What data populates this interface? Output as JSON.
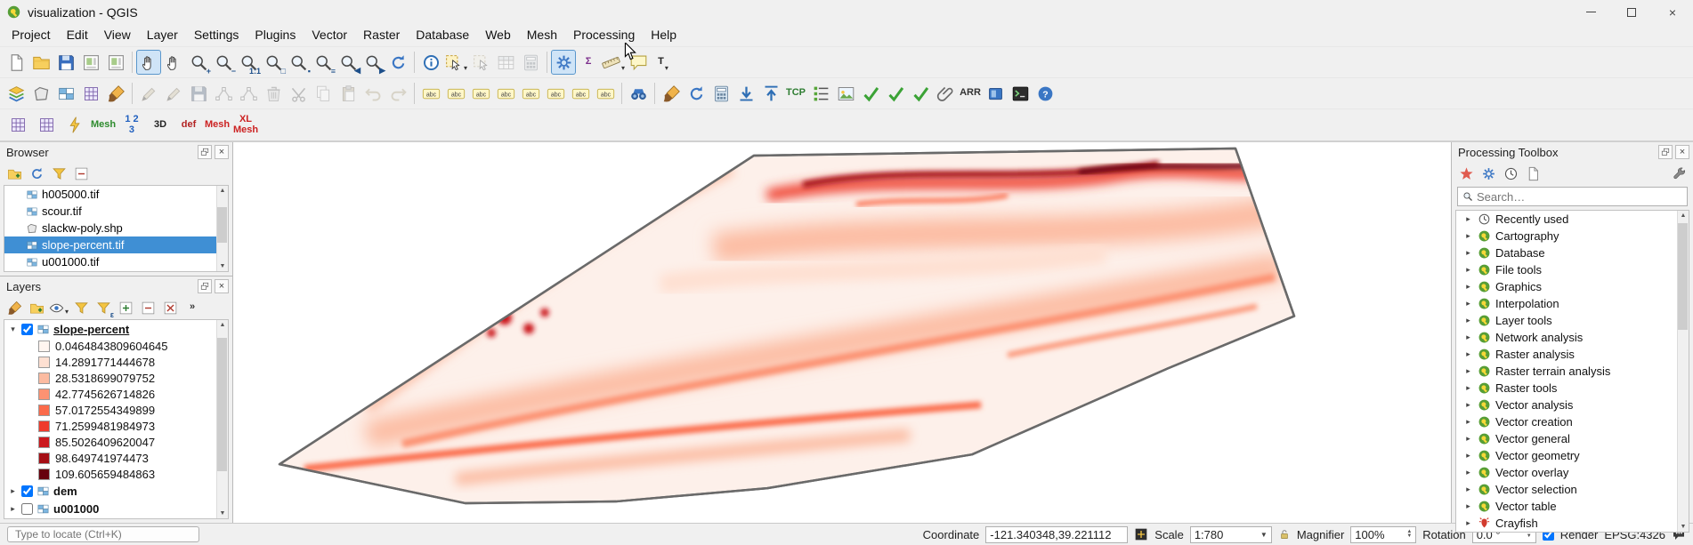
{
  "window": {
    "title": "visualization - QGIS"
  },
  "menu": {
    "items": [
      "Project",
      "Edit",
      "View",
      "Layer",
      "Settings",
      "Plugins",
      "Vector",
      "Raster",
      "Database",
      "Web",
      "Mesh",
      "Processing",
      "Help"
    ]
  },
  "toolbars": {
    "row1": [
      {
        "name": "new-project",
        "icon": "page"
      },
      {
        "name": "open-project",
        "icon": "folder"
      },
      {
        "name": "save-project",
        "icon": "disk"
      },
      {
        "name": "new-print-layout",
        "icon": "layout"
      },
      {
        "name": "show-layout-manager",
        "icon": "layout"
      },
      {
        "sep": true
      },
      {
        "name": "pan-map",
        "icon": "hand",
        "pressed": true
      },
      {
        "name": "pan-to-selection",
        "icon": "hand"
      },
      {
        "name": "zoom-in",
        "icon": "mag",
        "overlay": "+"
      },
      {
        "name": "zoom-out",
        "icon": "mag",
        "overlay": "−"
      },
      {
        "name": "zoom-native",
        "icon": "mag",
        "overlay": "1:1"
      },
      {
        "name": "zoom-full",
        "icon": "mag",
        "overlay": "□"
      },
      {
        "name": "zoom-to-selection",
        "icon": "mag",
        "overlay": "▪"
      },
      {
        "name": "zoom-to-layer",
        "icon": "mag",
        "overlay": "≡"
      },
      {
        "name": "zoom-last",
        "icon": "mag",
        "overlay": "◀"
      },
      {
        "name": "zoom-next",
        "icon": "mag",
        "overlay": "▶"
      },
      {
        "name": "refresh-map",
        "icon": "refresh"
      },
      {
        "sep": true
      },
      {
        "name": "identify-features",
        "icon": "info"
      },
      {
        "name": "select-features",
        "icon": "select",
        "caret": true
      },
      {
        "name": "deselect-features",
        "icon": "select",
        "disabled": true
      },
      {
        "name": "open-attribute-table",
        "icon": "table",
        "disabled": true
      },
      {
        "name": "field-calculator",
        "icon": "calc",
        "disabled": true
      },
      {
        "sep": true
      },
      {
        "name": "processing-toolbox-toggle",
        "icon": "gear",
        "pressed": true
      },
      {
        "name": "statistical-summary",
        "text": "Σ",
        "color": "#7b2d8b"
      },
      {
        "name": "measure",
        "icon": "ruler",
        "caret": true
      },
      {
        "name": "map-tips",
        "icon": "bubble"
      },
      {
        "name": "new-text-annotation",
        "text": "T",
        "color": "#222222",
        "caret": true
      }
    ],
    "row2": [
      {
        "name": "open-data-source-manager",
        "icon": "layers"
      },
      {
        "name": "new-vector-layer",
        "icon": "poly"
      },
      {
        "name": "new-raster-layer",
        "icon": "raster"
      },
      {
        "name": "new-mesh-layer",
        "icon": "grid"
      },
      {
        "name": "style-manager",
        "icon": "brush"
      },
      {
        "sep": true
      },
      {
        "name": "current-edits",
        "icon": "pencil",
        "disabled": true
      },
      {
        "name": "toggle-editing",
        "icon": "pencil",
        "disabled": true
      },
      {
        "name": "save-layer-edits",
        "icon": "disk",
        "disabled": true
      },
      {
        "name": "add-feature",
        "icon": "node",
        "disabled": true
      },
      {
        "name": "vertex-tool",
        "icon": "node",
        "disabled": true
      },
      {
        "name": "delete-selected",
        "icon": "trash",
        "disabled": true
      },
      {
        "name": "cut-features",
        "icon": "scissors",
        "disabled": true
      },
      {
        "name": "copy-features",
        "icon": "copy",
        "disabled": true
      },
      {
        "name": "paste-features",
        "icon": "paste",
        "disabled": true
      },
      {
        "name": "undo",
        "icon": "undo",
        "disabled": true
      },
      {
        "name": "redo",
        "icon": "redo",
        "disabled": true
      },
      {
        "sep": true
      },
      {
        "name": "layer-labeling",
        "icon": "abc"
      },
      {
        "name": "layer-diagram",
        "icon": "abc"
      },
      {
        "name": "highlight-pinned-labels",
        "icon": "abc"
      },
      {
        "name": "pin-unpin-labels",
        "icon": "abc"
      },
      {
        "name": "show-hide-labels",
        "icon": "abc"
      },
      {
        "name": "move-label",
        "icon": "abc"
      },
      {
        "name": "rotate-label",
        "icon": "abc"
      },
      {
        "name": "change-label",
        "icon": "abc"
      },
      {
        "sep": true
      },
      {
        "name": "find-place",
        "icon": "binoc"
      },
      {
        "sep": true
      },
      {
        "name": "copy-layer-style",
        "icon": "brush"
      },
      {
        "name": "reload-layer",
        "icon": "refresh"
      },
      {
        "name": "raster-calculator",
        "icon": "calc"
      },
      {
        "name": "import-layer",
        "icon": "down"
      },
      {
        "name": "export-layer",
        "icon": "up"
      },
      {
        "name": "tcp-connection",
        "text": "TCP",
        "color": "#2e7d32"
      },
      {
        "name": "legend-list",
        "icon": "list"
      },
      {
        "name": "export-map-image",
        "icon": "image"
      },
      {
        "name": "check-geometries",
        "icon": "check"
      },
      {
        "name": "check-topology",
        "icon": "check"
      },
      {
        "name": "validate-data",
        "icon": "check"
      },
      {
        "name": "attachments",
        "icon": "clip"
      },
      {
        "name": "arr-plugin",
        "text": "ARR",
        "color": "#333333"
      },
      {
        "name": "layout-panel",
        "icon": "bluerect"
      },
      {
        "name": "python-console",
        "icon": "term"
      },
      {
        "name": "help-contents",
        "icon": "help"
      }
    ],
    "row3": [
      {
        "name": "mesh-digitizing",
        "icon": "grid"
      },
      {
        "name": "mesh-calculator",
        "icon": "grid"
      },
      {
        "name": "mesh-dataset",
        "icon": "bolt"
      },
      {
        "name": "crayfish-mesh-arrows",
        "text": "Mesh",
        "color": "#2e8b2e"
      },
      {
        "name": "crayfish-123",
        "text": "1 2\n3",
        "color": "#1f5fbf"
      },
      {
        "name": "crayfish-3d",
        "text": "3D",
        "color": "#222222"
      },
      {
        "name": "crayfish-def",
        "text": "def",
        "color": "#b22222"
      },
      {
        "name": "crayfish-mesh-red",
        "text": "Mesh",
        "color": "#cc2222"
      },
      {
        "name": "crayfish-xl-mesh",
        "text": "XL\nMesh",
        "color": "#cc2222"
      }
    ],
    "browser": [
      {
        "name": "add-selected-layers",
        "icon": "foldplus"
      },
      {
        "name": "refresh-browser",
        "icon": "refresh"
      },
      {
        "name": "filter-browser",
        "icon": "funnel"
      },
      {
        "name": "collapse-browser",
        "icon": "collapse"
      }
    ],
    "layers": [
      {
        "name": "open-layer-styling-panel",
        "icon": "brush"
      },
      {
        "name": "add-group",
        "icon": "foldplus"
      },
      {
        "name": "manage-map-themes",
        "icon": "eye",
        "caret": true
      },
      {
        "name": "filter-legend",
        "icon": "funnel"
      },
      {
        "name": "filter-legend-by-expression",
        "icon": "funnel",
        "overlay": "ε"
      },
      {
        "name": "expand-all",
        "icon": "expand"
      },
      {
        "name": "collapse-all",
        "icon": "collapse"
      },
      {
        "name": "remove-layer",
        "icon": "remove"
      },
      {
        "name": "layers-toolbar-overflow",
        "text": "»",
        "color": "#333333"
      }
    ],
    "processing": [
      {
        "name": "processing-models",
        "icon": "star"
      },
      {
        "name": "processing-scripts",
        "icon": "gear"
      },
      {
        "name": "processing-history",
        "icon": "clock"
      },
      {
        "name": "processing-results",
        "icon": "page"
      },
      {
        "flex": true
      },
      {
        "name": "processing-options",
        "icon": "wrench"
      }
    ]
  },
  "browser": {
    "title": "Browser",
    "items": [
      {
        "label": "h005000.tif",
        "icon": "raster"
      },
      {
        "label": "scour.tif",
        "icon": "raster"
      },
      {
        "label": "slackw-poly.shp",
        "icon": "poly"
      },
      {
        "label": "slope-percent.tif",
        "icon": "raster",
        "selected": true
      },
      {
        "label": "u001000.tif",
        "icon": "raster"
      }
    ]
  },
  "layers": {
    "title": "Layers",
    "items": [
      {
        "name": "slope-percent",
        "checked": true,
        "expanded": true,
        "current": true,
        "classes": [
          {
            "value": "0.0464843809604645",
            "color": "#fff5f0"
          },
          {
            "value": "14.2891771444678",
            "color": "#fee0d2"
          },
          {
            "value": "28.5318699079752",
            "color": "#fcbba1"
          },
          {
            "value": "42.7745626714826",
            "color": "#fc9272"
          },
          {
            "value": "57.0172554349899",
            "color": "#fb6a4a"
          },
          {
            "value": "71.2599481984973",
            "color": "#ef3b2c"
          },
          {
            "value": "85.5026409620047",
            "color": "#cb181d"
          },
          {
            "value": "98.649741974473",
            "color": "#a50f15"
          },
          {
            "value": "109.605659484863",
            "color": "#67000d"
          }
        ]
      },
      {
        "name": "dem",
        "checked": true,
        "expanded": false
      },
      {
        "name": "u001000",
        "checked": false,
        "expanded": false
      }
    ]
  },
  "processing": {
    "title": "Processing Toolbox",
    "search_placeholder": "Search…",
    "groups": [
      {
        "label": "Recently used",
        "icon": "clock"
      },
      {
        "label": "Cartography",
        "icon": "qgis"
      },
      {
        "label": "Database",
        "icon": "qgis"
      },
      {
        "label": "File tools",
        "icon": "qgis"
      },
      {
        "label": "Graphics",
        "icon": "qgis"
      },
      {
        "label": "Interpolation",
        "icon": "qgis"
      },
      {
        "label": "Layer tools",
        "icon": "qgis"
      },
      {
        "label": "Network analysis",
        "icon": "qgis"
      },
      {
        "label": "Raster analysis",
        "icon": "qgis"
      },
      {
        "label": "Raster terrain analysis",
        "icon": "qgis"
      },
      {
        "label": "Raster tools",
        "icon": "qgis"
      },
      {
        "label": "Vector analysis",
        "icon": "qgis"
      },
      {
        "label": "Vector creation",
        "icon": "qgis"
      },
      {
        "label": "Vector general",
        "icon": "qgis"
      },
      {
        "label": "Vector geometry",
        "icon": "qgis"
      },
      {
        "label": "Vector overlay",
        "icon": "qgis"
      },
      {
        "label": "Vector selection",
        "icon": "qgis"
      },
      {
        "label": "Vector table",
        "icon": "qgis"
      },
      {
        "label": "Crayfish",
        "icon": "cray"
      }
    ]
  },
  "statusbar": {
    "locate_placeholder": "Type to locate (Ctrl+K)",
    "coordinate_label": "Coordinate",
    "coordinate_value": "-121.340348,39.221112",
    "scale_label": "Scale",
    "scale_value": "1:780",
    "magnifier_label": "Magnifier",
    "magnifier_value": "100%",
    "rotation_label": "Rotation",
    "rotation_value": "0.0 °",
    "render_label": "Render",
    "crs": "EPSG:4326"
  }
}
